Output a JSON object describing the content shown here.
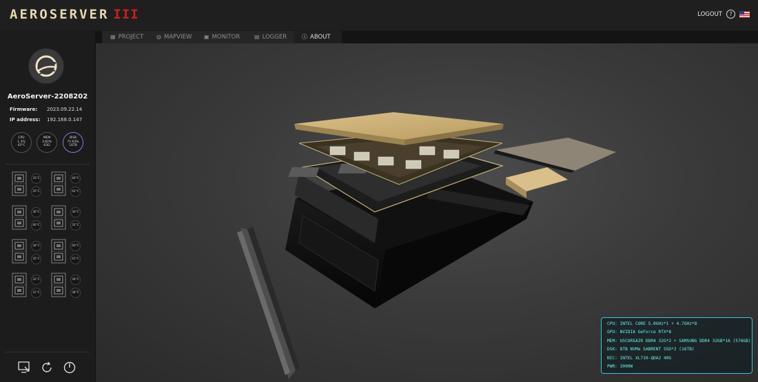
{
  "app": {
    "logo_text": "AEROSERVER",
    "logo_mark": "III"
  },
  "header": {
    "logout_label": "LOGOUT",
    "help_icon": "question-circle-icon",
    "flag_icon": "us-flag-icon"
  },
  "sidebar": {
    "server_name": "AeroServer-2208202",
    "firmware_label": "Firmware:",
    "firmware_value": "2023.09.22.14",
    "ip_label": "IP address:",
    "ip_value": "192.168.0.147",
    "gauges": [
      {
        "label": "CPU",
        "line1": "1.3%",
        "line2": "43°C"
      },
      {
        "label": "MEM",
        "line1": "3.82%",
        "line2": "63G"
      },
      {
        "label": "DISK",
        "line1": "75.63%",
        "line2": "16TB"
      }
    ],
    "chips": [
      {
        "t1": "33°C",
        "t2": "35°C"
      },
      {
        "t1": "40°C",
        "t2": "42°C"
      },
      {
        "t1": "36°C",
        "t2": "40°C"
      },
      {
        "t1": "30°C",
        "t2": "32°C"
      },
      {
        "t1": "34°C",
        "t2": "35°C"
      },
      {
        "t1": "40°C",
        "t2": "41°C"
      },
      {
        "t1": "32°C",
        "t2": "31°C"
      },
      {
        "t1": "39°C",
        "t2": "38°C"
      }
    ],
    "bottom_icons": [
      "remote-desktop-icon",
      "refresh-icon",
      "power-icon"
    ]
  },
  "tabs": [
    {
      "label": "PROJECT",
      "icon": "grid-icon"
    },
    {
      "label": "MAPVIEW",
      "icon": "globe-icon"
    },
    {
      "label": "MONITOR",
      "icon": "monitor-icon"
    },
    {
      "label": "LOGGER",
      "icon": "clipboard-icon"
    },
    {
      "label": "ABOUT",
      "icon": "info-icon",
      "active": true
    }
  ],
  "specs": [
    "CPU: INTEL CORE 5.0GHz*1 + 4.7GHz*8",
    "GPU: NVIDIA GeForce RTX*8",
    "MEM: USCORSAIR DDR4 32G*2 + SAMSUNG DDR4 32GB*16 (576GB)",
    "DSK: 8TB NVMe SABRENT SSD*2 (16TB)",
    "NIC: INTEL XL710-QDA2 40G",
    "PWR: 3000W"
  ],
  "colors": {
    "accent_gold": "#e6d7b3",
    "logo_red": "#cc1f1f",
    "spec_cyan": "#39c6d6"
  }
}
